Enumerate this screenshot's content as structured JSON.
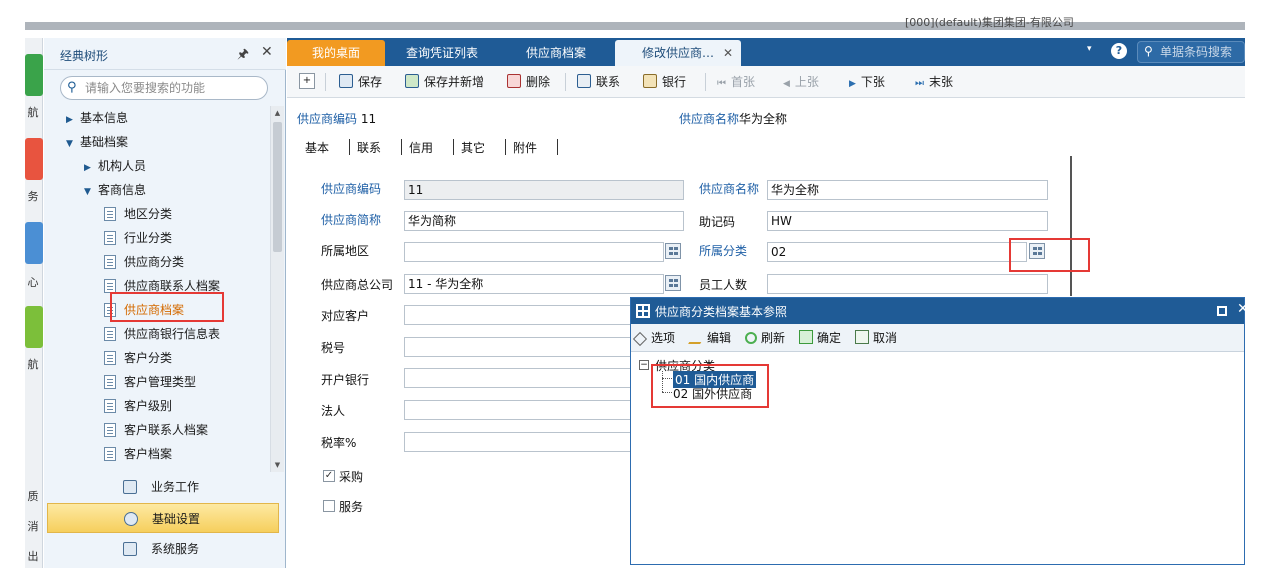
{
  "window": {
    "title_partial": "[000](default)集团集团-有限公司"
  },
  "rail": {
    "items": [
      "航",
      "务",
      "心",
      "航",
      "质",
      "消",
      "出"
    ]
  },
  "left_panel": {
    "title": "经典树形",
    "search_placeholder": "请输入您要搜索的功能",
    "tree": [
      {
        "label": "基本信息",
        "level": 1,
        "type": "folder",
        "expanded": false
      },
      {
        "label": "基础档案",
        "level": 1,
        "type": "folder",
        "expanded": true
      },
      {
        "label": "机构人员",
        "level": 2,
        "type": "folder",
        "expanded": false
      },
      {
        "label": "客商信息",
        "level": 2,
        "type": "folder",
        "expanded": true
      },
      {
        "label": "地区分类",
        "level": 3,
        "type": "doc"
      },
      {
        "label": "行业分类",
        "level": 3,
        "type": "doc"
      },
      {
        "label": "供应商分类",
        "level": 3,
        "type": "doc"
      },
      {
        "label": "供应商联系人档案",
        "level": 3,
        "type": "doc"
      },
      {
        "label": "供应商档案",
        "level": 3,
        "type": "doc",
        "highlighted": true
      },
      {
        "label": "供应商银行信息表",
        "level": 3,
        "type": "doc"
      },
      {
        "label": "客户分类",
        "level": 3,
        "type": "doc"
      },
      {
        "label": "客户管理类型",
        "level": 3,
        "type": "doc"
      },
      {
        "label": "客户级别",
        "level": 3,
        "type": "doc"
      },
      {
        "label": "客户联系人档案",
        "level": 3,
        "type": "doc"
      },
      {
        "label": "客户档案",
        "level": 3,
        "type": "doc"
      }
    ],
    "bottom_nav": [
      {
        "label": "业务工作",
        "active": false
      },
      {
        "label": "基础设置",
        "active": true
      },
      {
        "label": "系统服务",
        "active": false
      }
    ]
  },
  "tabs": [
    {
      "label": "我的桌面"
    },
    {
      "label": "查询凭证列表"
    },
    {
      "label": "供应商档案"
    },
    {
      "label": "修改供应商…",
      "closable": true,
      "active": true
    }
  ],
  "topright": {
    "search_placeholder": "单据条码搜索",
    "help": "?"
  },
  "toolbar": {
    "save": "保存",
    "save_new": "保存并新增",
    "delete": "删除",
    "contact": "联系",
    "bank": "银行",
    "first": "首张",
    "prev": "上张",
    "next": "下张",
    "last": "末张"
  },
  "header": {
    "code_label": "供应商编码",
    "code_value": "11",
    "name_label": "供应商名称",
    "name_value": "华为全称"
  },
  "subtabs": [
    "基本",
    "联系",
    "信用",
    "其它",
    "附件"
  ],
  "form": {
    "supplier_code": {
      "label": "供应商编码",
      "value": "11"
    },
    "supplier_name": {
      "label": "供应商名称",
      "value": "华为全称"
    },
    "supplier_abbr": {
      "label": "供应商简称",
      "value": "华为简称"
    },
    "mnemonic": {
      "label": "助记码",
      "value": "HW"
    },
    "region": {
      "label": "所属地区",
      "value": ""
    },
    "category": {
      "label": "所属分类",
      "value": "02"
    },
    "parent_company": {
      "label": "供应商总公司",
      "value": "11 - 华为全称"
    },
    "employees": {
      "label": "员工人数",
      "value": ""
    },
    "customer": {
      "label": "对应客户",
      "value": ""
    },
    "tax_no": {
      "label": "税号",
      "value": ""
    },
    "bank": {
      "label": "开户银行",
      "value": ""
    },
    "legal": {
      "label": "法人",
      "value": ""
    },
    "tax_rate": {
      "label": "税率%",
      "value": ""
    },
    "purchase": {
      "label": "采购",
      "checked": true,
      "mark": "✓"
    },
    "service": {
      "label": "服务",
      "checked": false,
      "mark": ""
    }
  },
  "dialog": {
    "title": "供应商分类档案基本参照",
    "toolbar": {
      "options": "选项",
      "edit": "编辑",
      "refresh": "刷新",
      "ok": "确定",
      "cancel": "取消"
    },
    "tree": {
      "root": "供应商分类",
      "root_toggle": "−",
      "items": [
        {
          "label": "01 国内供应商",
          "selected": true
        },
        {
          "label": "02 国外供应商",
          "selected": false
        }
      ]
    }
  },
  "icons": {
    "search": "⚲",
    "pin": "🖈",
    "close": "✕",
    "chevron_right": "▶",
    "chevron_down": "▼",
    "scroll_up": "▲",
    "scroll_down": "▼",
    "dropdown": "▾",
    "first": "⏮",
    "prev": "◀",
    "next": "▶",
    "last": "⏭"
  },
  "colors": {
    "tab_bar": "#1f5b96",
    "active_tab_orange": "#f29a21",
    "required_label": "#1e5fa6",
    "annotation_red": "#e53935",
    "nav_active": "#f6cf5d"
  }
}
